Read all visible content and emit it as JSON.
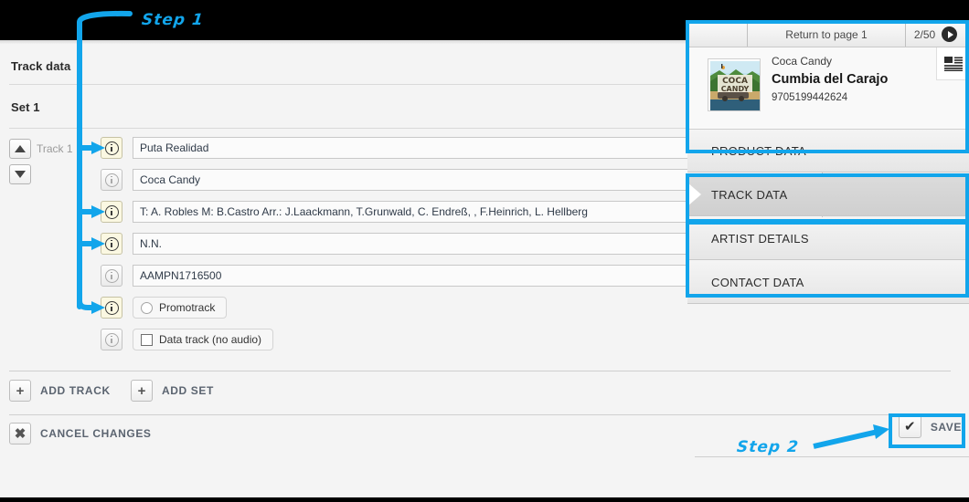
{
  "annotations": {
    "step1": "Step 1",
    "step2": "Step 2",
    "accent_color": "#12a5eb"
  },
  "main": {
    "section_title": "Track data",
    "set_title": "Set 1",
    "track_label": "Track 1",
    "move_up_icon": "triangle-up-icon",
    "move_down_icon": "triangle-down-icon",
    "fields": [
      {
        "value": "Puta Realidad",
        "info_highlighted": true,
        "arrow": true
      },
      {
        "value": "Coca Candy",
        "info_highlighted": false,
        "arrow": false
      },
      {
        "value": "T: A. Robles M: B.Castro Arr.: J.Laackmann, T.Grunwald, C. Endreß, , F.Heinrich, L. Hellberg",
        "info_highlighted": true,
        "arrow": true
      },
      {
        "value": "N.N.",
        "info_highlighted": true,
        "arrow": true
      },
      {
        "value": "AAMPN1716500",
        "info_highlighted": false,
        "arrow": false
      }
    ],
    "options": [
      {
        "label": "Promotrack",
        "control": "radio",
        "checked": false,
        "info_highlighted": true,
        "arrow": true
      },
      {
        "label": "Data track (no audio)",
        "control": "checkbox",
        "checked": false,
        "info_highlighted": false,
        "arrow": false
      }
    ],
    "actions": [
      {
        "label": "ADD TRACK",
        "icon": "plus-icon",
        "glyph": "+"
      },
      {
        "label": "ADD SET",
        "icon": "plus-icon",
        "glyph": "+"
      },
      {
        "label": "CANCEL CHANGES",
        "icon": "close-icon",
        "glyph": "✖"
      }
    ],
    "save": {
      "label": "SAVE",
      "icon": "check-icon",
      "glyph": "✔"
    }
  },
  "sidepanel": {
    "header": {
      "blank_cell": "",
      "return_label": "Return to page 1",
      "page_indicator": "2/50",
      "next_icon": "play-next-icon"
    },
    "record": {
      "artist": "Coca Candy",
      "title": "Cumbia del Carajo",
      "code": "9705199442624",
      "cover_alt": "coca-candy-album-cover",
      "list_icon": "article-list-icon"
    },
    "nav_items": [
      {
        "label": "PRODUCT DATA",
        "active": false
      },
      {
        "label": "TRACK DATA",
        "active": true
      },
      {
        "label": "ARTIST DETAILS",
        "active": false
      },
      {
        "label": "CONTACT DATA",
        "active": false
      }
    ]
  }
}
